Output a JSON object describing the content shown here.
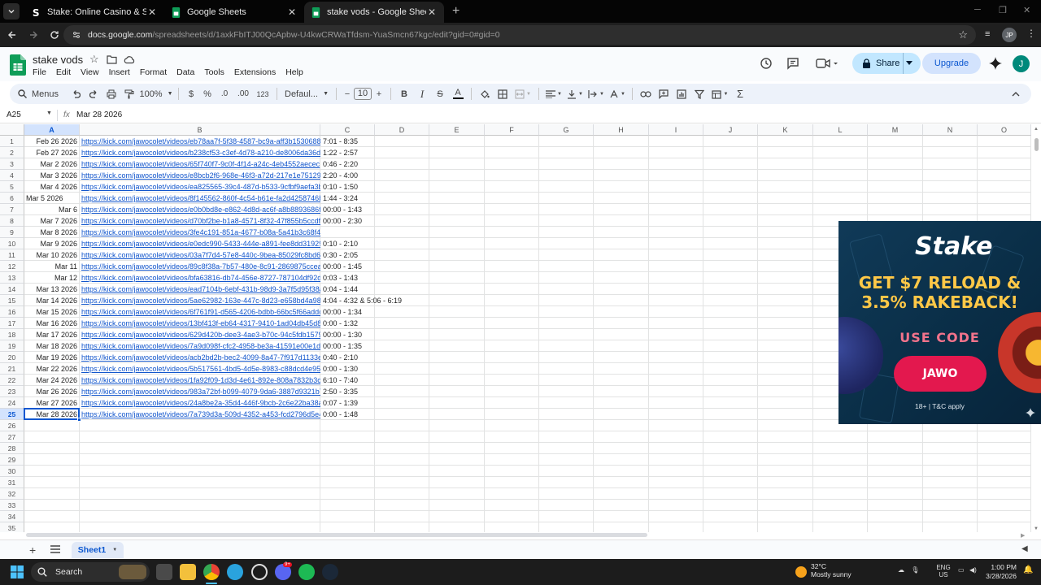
{
  "browser": {
    "tabs": [
      {
        "title": "Stake: Online Casino & Sports B",
        "favicon": "stake-icon",
        "active": false
      },
      {
        "title": "Google Sheets",
        "favicon": "sheets-icon",
        "active": false
      },
      {
        "title": "stake vods - Google Sheets",
        "favicon": "sheets-icon",
        "active": true
      }
    ],
    "url_host": "docs.google.com",
    "url_path": "/spreadsheets/d/1axkFbITJ00QcApbw-U4kwCRWaTfdsm-YuaSmcn67kgc/edit?gid=0#gid=0",
    "profile": "JP"
  },
  "sheet": {
    "title": "stake vods",
    "menus": [
      "File",
      "Edit",
      "View",
      "Insert",
      "Format",
      "Data",
      "Tools",
      "Extensions",
      "Help"
    ],
    "share_label": "Share",
    "upgrade_label": "Upgrade",
    "user_initial": "J",
    "accent": "#0b57d0"
  },
  "toolbar": {
    "menus_label": "Menus",
    "zoom": "100%",
    "currency": "$",
    "percent": "%",
    "dec_less": ".0",
    "dec_more": ".00",
    "num_format": "123",
    "font": "Defaul...",
    "font_size": "10",
    "bold": "B",
    "italic": "I",
    "strike": "S",
    "textcolor": "A"
  },
  "formula": {
    "name_box": "A25",
    "fx": "fx",
    "value": "Mar 28 2026"
  },
  "columns": [
    {
      "label": "A"
    },
    {
      "label": "B"
    },
    {
      "label": "C"
    },
    {
      "label": "D"
    },
    {
      "label": "E"
    },
    {
      "label": "F"
    },
    {
      "label": "G"
    },
    {
      "label": "H"
    },
    {
      "label": "I"
    },
    {
      "label": "J"
    },
    {
      "label": "K"
    },
    {
      "label": "L"
    },
    {
      "label": "M"
    },
    {
      "label": "N"
    },
    {
      "label": "O"
    }
  ],
  "selected_cell": {
    "row": 25,
    "col": "A"
  },
  "rows": [
    {
      "n": "1",
      "date": "Feb 26 2026",
      "link": "https://kick.com/jawocolet/videos/eb78aa7f-5f38-4587-bc9a-aff3b1530688",
      "time": "7:01 - 8:35"
    },
    {
      "n": "2",
      "date": "Feb 27 2026",
      "link": "https://kick.com/jawocolet/videos/b238cf53-c3ef-4d78-a210-de8006da36d0",
      "time": "1:22 - 2:57"
    },
    {
      "n": "3",
      "date": "Mar 2 2026",
      "link": "https://kick.com/jawocolet/videos/65f740f7-9c0f-4f14-a24c-4eb4552aecec",
      "time": "0:46 - 2:20"
    },
    {
      "n": "4",
      "date": "Mar 3 2026",
      "link": "https://kick.com/jawocolet/videos/e8bcb2f6-968e-46f3-a72d-217e1e75129",
      "time": "2:20 - 4:00"
    },
    {
      "n": "5",
      "date": "Mar 4 2026",
      "link": "https://kick.com/jawocolet/videos/ea825565-39c4-487d-b533-9cfbf9aefa3b",
      "time": "0:10 - 1:50"
    },
    {
      "n": "6",
      "date": "Mar 5 2026",
      "link": "https://kick.com/jawocolet/videos/8f145562-860f-4c54-b61e-fa2d4258746b",
      "time": "1:44 - 3:24",
      "left": true
    },
    {
      "n": "7",
      "date": "Mar 6",
      "link": "https://kick.com/jawocolet/videos/e0b0bd8e-e862-4d8d-ac6f-a8b8893686f0",
      "time": "00:00 - 1:43"
    },
    {
      "n": "8",
      "date": "Mar 7 2026",
      "link": "https://kick.com/jawocolet/videos/d70bf2be-b1a8-4571-8f32-47f855b5ccdf",
      "time": "00:00 - 2:30"
    },
    {
      "n": "9",
      "date": "Mar 8 2026",
      "link": "https://kick.com/jawocolet/videos/3fe4c191-851a-4677-b08a-5a41b3c68f47",
      "time": ""
    },
    {
      "n": "10",
      "date": "Mar 9 2026",
      "link": "https://kick.com/jawocolet/videos/e0edc990-5433-444e-a891-fee8dd31929",
      "time": "0:10 - 2:10"
    },
    {
      "n": "11",
      "date": "Mar 10 2026",
      "link": "https://kick.com/jawocolet/videos/03a7f7d4-57e8-440c-9bea-85029fc8bd69",
      "time": "0:30 - 2:05"
    },
    {
      "n": "12",
      "date": "Mar 11",
      "link": "https://kick.com/jawocolet/videos/89c8f38a-7b57-480e-8c91-2869875cceal",
      "time": "00:00 - 1:45"
    },
    {
      "n": "13",
      "date": "Mar 12",
      "link": "https://kick.com/jawocolet/videos/bfa63816-db74-456e-8727-787104df92d",
      "time": "0:03 - 1:43"
    },
    {
      "n": "14",
      "date": "Mar 13 2026",
      "link": "https://kick.com/jawocolet/videos/ead7104b-6ebf-431b-98d9-3a7f5d95f38a",
      "time": "0:04 - 1:44"
    },
    {
      "n": "15",
      "date": "Mar 14 2026",
      "link": "https://kick.com/jawocolet/videos/5ae62982-163e-447c-8d23-e658bd4a987",
      "time": "4:04 - 4:32 & 5:06 - 6:19"
    },
    {
      "n": "16",
      "date": "Mar 15 2026",
      "link": "https://kick.com/jawocolet/videos/6f761f91-d565-4206-bdbb-66bc5f66addc",
      "time": "00:00 - 1:34"
    },
    {
      "n": "17",
      "date": "Mar 16 2026",
      "link": "https://kick.com/jawocolet/videos/13bf413f-eb64-4317-9410-1ad04db45d8",
      "time": "0:00 - 1:32"
    },
    {
      "n": "18",
      "date": "Mar 17 2026",
      "link": "https://kick.com/jawocolet/videos/629d420b-dee3-4ae3-b70c-94c5fdb1579",
      "time": "00:00 - 1:30"
    },
    {
      "n": "19",
      "date": "Mar 18 2026",
      "link": "https://kick.com/jawocolet/videos/7a9d098f-cfc2-4958-be3a-41591e00e1da",
      "time": "00:00 - 1:35"
    },
    {
      "n": "20",
      "date": "Mar 19 2026",
      "link": "https://kick.com/jawocolet/videos/acb2bd2b-bec2-4099-8a47-7f917d1133e",
      "time": "0:40 - 2:10"
    },
    {
      "n": "21",
      "date": "Mar 22 2026",
      "link": "https://kick.com/jawocolet/videos/5b517561-4bd5-4d5e-8983-c88dcd4e95b",
      "time": "0:00 - 1:30"
    },
    {
      "n": "22",
      "date": "Mar 24 2026",
      "link": "https://kick.com/jawocolet/videos/1fa92f09-1d3d-4e61-892e-808a7832b3c",
      "time": "6:10 - 7:40"
    },
    {
      "n": "23",
      "date": "Mar 26 2026",
      "link": "https://kick.com/jawocolet/videos/983a72bf-b099-4079-9da6-3887d9321b7",
      "time": "2:50 - 3:35"
    },
    {
      "n": "24",
      "date": "Mar 27 2026",
      "link": "https://kick.com/jawocolet/videos/24a8be2a-35d4-446f-9bcb-2c6e22ba38a",
      "time": "0:07 - 1:39"
    },
    {
      "n": "25",
      "date": "Mar 28 2026",
      "link": "https://kick.com/jawocolet/videos/7a739d3a-509d-4352-a453-fcd2796d5e4",
      "time": "0:00 - 1:48"
    },
    {
      "n": "26"
    },
    {
      "n": "27"
    },
    {
      "n": "28"
    },
    {
      "n": "29"
    },
    {
      "n": "30"
    },
    {
      "n": "31"
    },
    {
      "n": "32"
    },
    {
      "n": "33"
    },
    {
      "n": "34"
    },
    {
      "n": "35"
    }
  ],
  "ad": {
    "brand": "Stake",
    "headline1": "GET $7 RELOAD &",
    "headline2": "3.5% RAKEBACK!",
    "code_label": "USE CODE",
    "code": "JAWO",
    "terms": "18+ | T&C apply",
    "gold": "#ffc847",
    "red": "#e3184e"
  },
  "sheet_tabs": [
    {
      "name": "Sheet1",
      "active": true
    }
  ],
  "taskbar": {
    "search_label": "Search",
    "weather_temp": "32°C",
    "weather_desc": "Mostly sunny",
    "lang1": "ENG",
    "lang2": "US",
    "time": "1:00 PM",
    "date": "3/28/2026",
    "discord_badge": "9+"
  }
}
